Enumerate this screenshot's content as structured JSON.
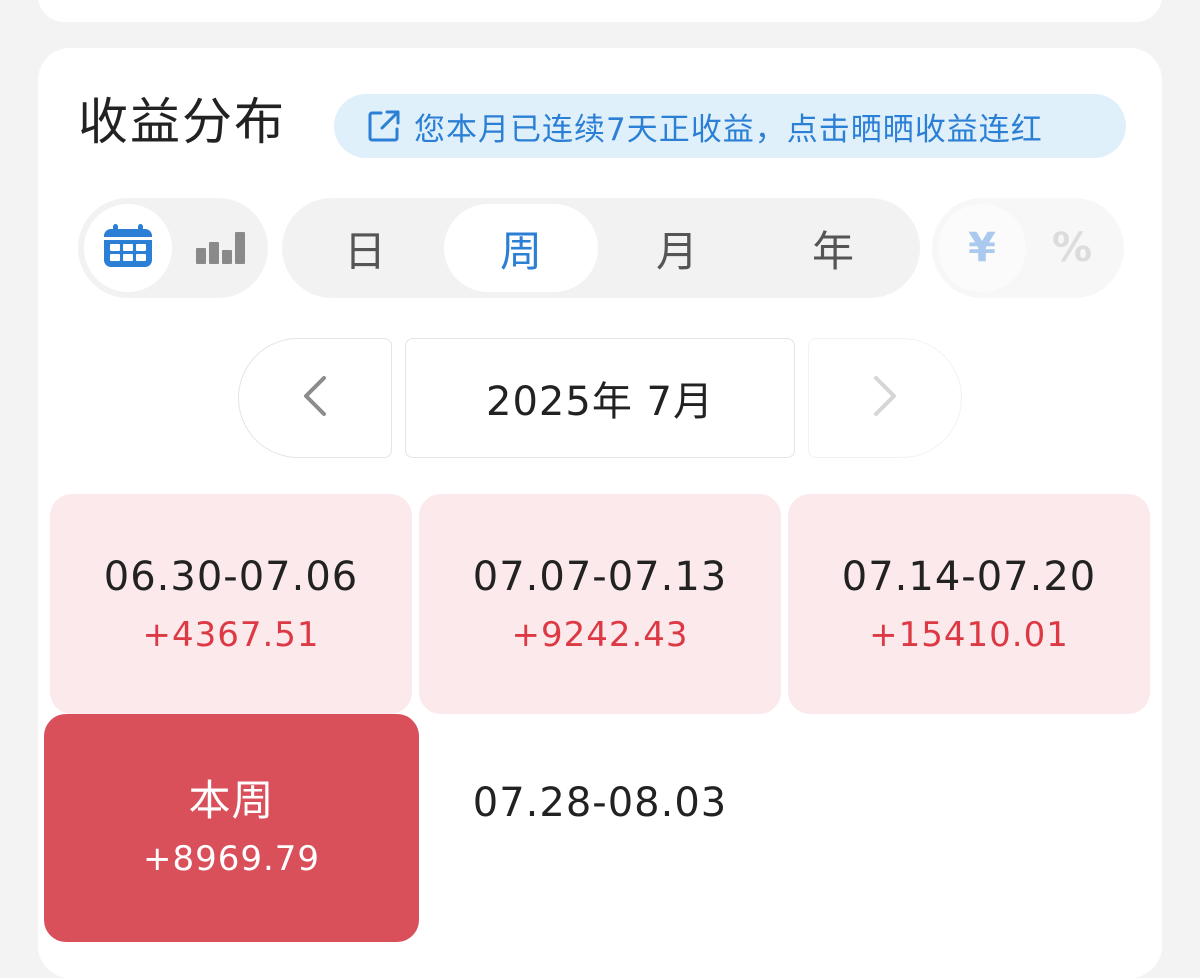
{
  "section": {
    "title": "收益分布",
    "banner": "您本月已连续7天正收益，点击晒晒收益连红"
  },
  "view_toggle": [
    "calendar-view",
    "bar-chart-view"
  ],
  "period_tabs": [
    {
      "label": "日",
      "active": false
    },
    {
      "label": "周",
      "active": true
    },
    {
      "label": "月",
      "active": false
    },
    {
      "label": "年",
      "active": false
    }
  ],
  "unit_toggle": {
    "yuan": "¥",
    "percent": "%"
  },
  "month_nav": {
    "current": "2025年 7月"
  },
  "weeks": [
    {
      "range": "06.30-07.06",
      "amount": "+4367.51"
    },
    {
      "range": "07.07-07.13",
      "amount": "+9242.43"
    },
    {
      "range": "07.14-07.20",
      "amount": "+15410.01"
    },
    {
      "range": "本周",
      "amount": "+8969.79"
    },
    {
      "range": "07.28-08.03",
      "amount": ""
    }
  ],
  "colors": {
    "accent_blue": "#2b7fd4",
    "gain_red": "#dc3945",
    "gain_bg": "#fbe9eb",
    "current_week_bg": "#d9505b"
  }
}
